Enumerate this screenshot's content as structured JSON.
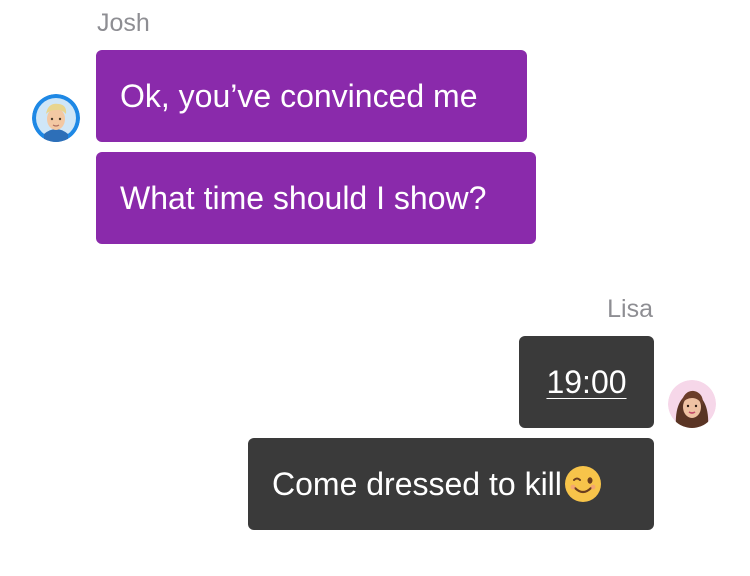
{
  "conversation": {
    "messages": [
      {
        "sender": "Josh",
        "text": "Ok, you’ve convinced me",
        "color": "#8a2aab"
      },
      {
        "sender": "Josh",
        "text": "What time should I show?",
        "color": "#8a2aab"
      },
      {
        "sender": "Lisa",
        "text": "19:00",
        "color": "#3a3a3a"
      },
      {
        "sender": "Lisa",
        "text": "Come dressed to kill",
        "emoji": "winking-face-icon",
        "color": "#3a3a3a"
      }
    ],
    "participants": {
      "josh": {
        "name": "Josh",
        "avatar": "josh-avatar"
      },
      "lisa": {
        "name": "Lisa",
        "avatar": "lisa-avatar"
      }
    }
  }
}
